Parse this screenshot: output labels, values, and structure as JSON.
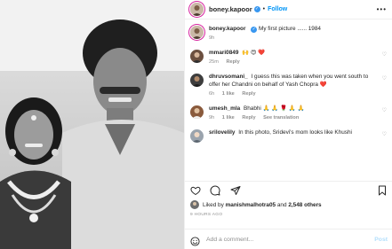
{
  "post": {
    "username": "boney.kapoor",
    "verified_mark": "✓",
    "separator": "•",
    "follow_label": "Follow",
    "more_label": "•••",
    "caption_user": "boney.kapoor",
    "caption_text": "My first picture ...... 1984",
    "caption_age": "9h"
  },
  "comments": [
    {
      "user": "mmari0849",
      "text": "🙌 😍 ❤️",
      "age": "25m",
      "likes": "",
      "reply": "Reply",
      "translation": ""
    },
    {
      "user": "dhruvsomani_",
      "text": "I guess this was taken when you went south to offer her Chandni on behalf of Yash Chopra ❤️",
      "age": "6h",
      "likes": "1 like",
      "reply": "Reply",
      "translation": ""
    },
    {
      "user": "umesh_mla",
      "text": "Bhabhi 🙏 🙏 🌹 🙏 🙏",
      "age": "9h",
      "likes": "1 like",
      "reply": "Reply",
      "translation": "See translation"
    },
    {
      "user": "srilovelily",
      "text": "In this photo, Sridevi's mom looks like Khushi",
      "age": "",
      "likes": "",
      "reply": "",
      "translation": ""
    }
  ],
  "engagement": {
    "liked_by_prefix": "Liked by",
    "liked_by_user": "manishmalhotra05",
    "and": "and",
    "others": "2,548 others",
    "time_ago": "9 HOURS AGO"
  },
  "composer": {
    "placeholder": "Add a comment...",
    "post_label": "Post"
  },
  "icons": {
    "like": "heart-icon",
    "comment": "comment-icon",
    "share": "share-icon",
    "save": "bookmark-icon",
    "emoji": "smiley-icon",
    "verified": "verified-badge-icon"
  },
  "colors": {
    "accent": "#0095f6",
    "verified": "#3897f0",
    "muted": "#8e8e8e",
    "post_disabled": "#b2dffc"
  }
}
